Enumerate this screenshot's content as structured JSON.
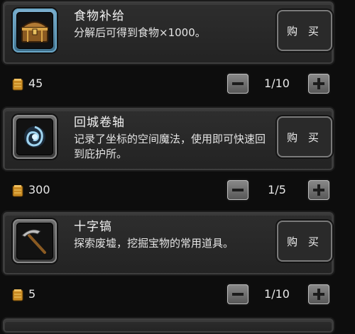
{
  "items": [
    {
      "name": "食物补给",
      "description": "分解后可得到食物×1000。",
      "buy_label": "购 买",
      "price": "45",
      "quantity": "1/10",
      "icon": "treasure-chest-icon",
      "selected": true
    },
    {
      "name": "回城卷轴",
      "description": "记录了坐标的空间魔法，使用即可快速回到庇护所。",
      "buy_label": "购 买",
      "price": "300",
      "quantity": "1/5",
      "icon": "teleport-scroll-icon",
      "selected": false
    },
    {
      "name": "十字镐",
      "description": "探索废墟，挖掘宝物的常用道具。",
      "buy_label": "购 买",
      "price": "5",
      "quantity": "1/10",
      "icon": "pickaxe-icon",
      "selected": false
    }
  ],
  "colors": {
    "card": "#2a2a2a",
    "selected_frame": "#6aa6c6",
    "coin": "#e0a83a"
  }
}
